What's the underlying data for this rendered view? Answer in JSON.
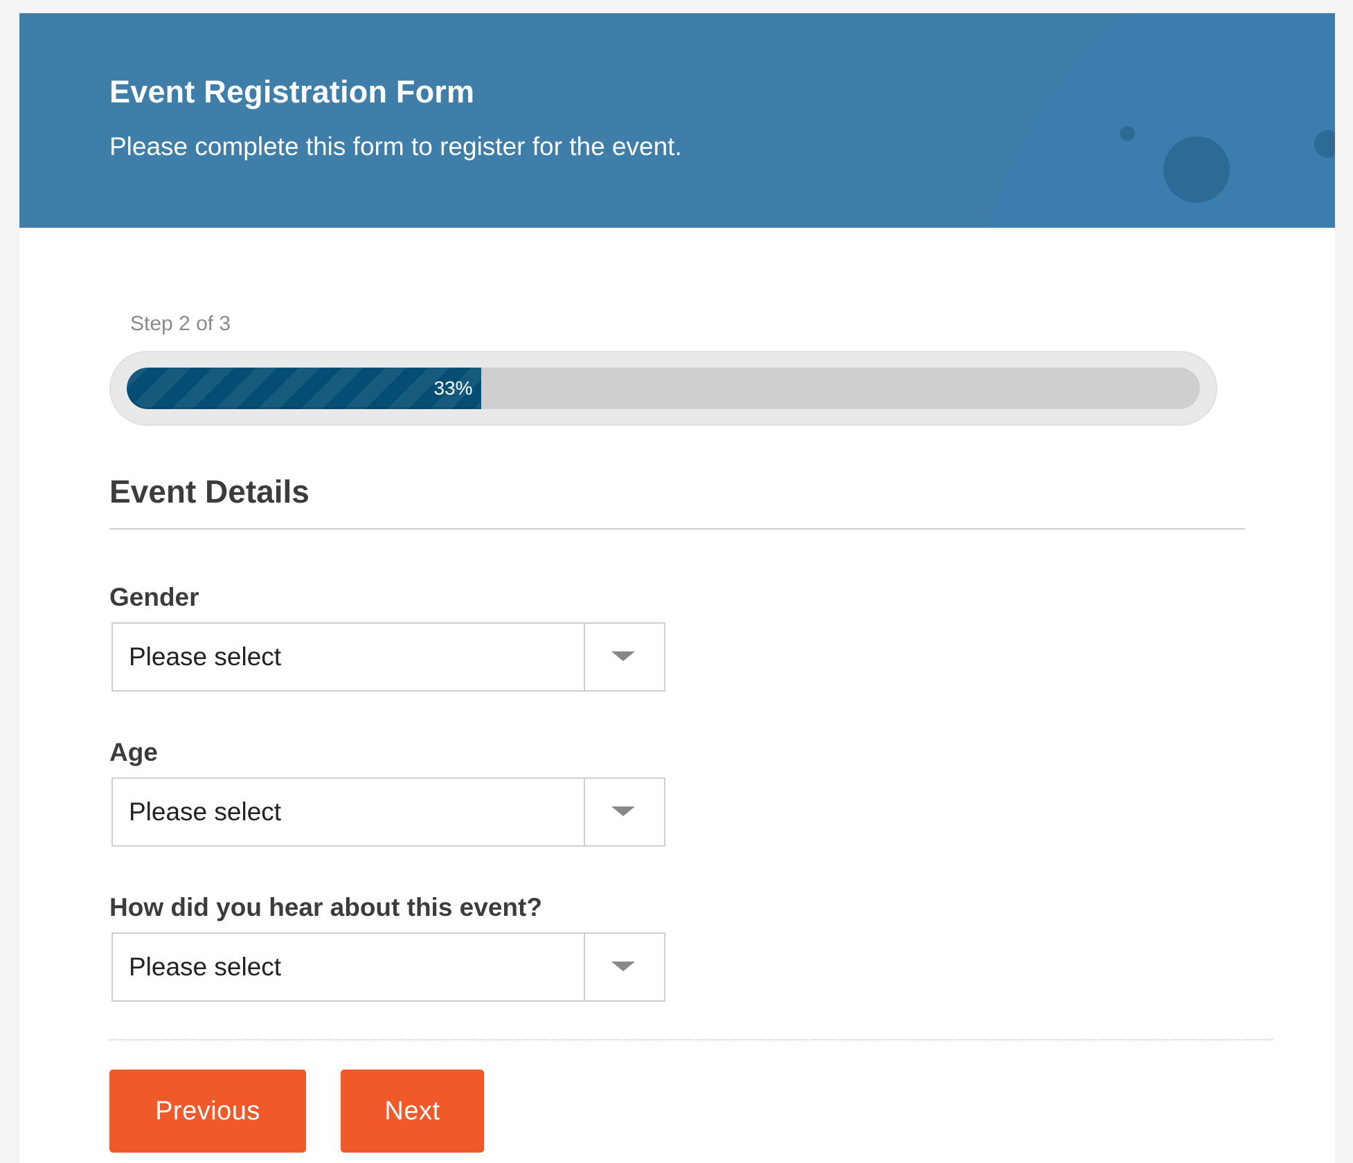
{
  "header": {
    "title": "Event Registration Form",
    "subtitle": "Please complete this form to register for the event.",
    "background_color": "#3f7ea9"
  },
  "progress": {
    "step_text": "Step 2 of 3",
    "percent": 33,
    "percent_label": "33%",
    "fill_color": "#044d73"
  },
  "section": {
    "title": "Event Details"
  },
  "fields": [
    {
      "label": "Gender",
      "value": "Please select",
      "icon": "chevron-down-icon"
    },
    {
      "label": "Age",
      "value": "Please select",
      "icon": "chevron-down-icon"
    },
    {
      "label": "How did you hear about this event?",
      "value": "Please select",
      "icon": "chevron-down-icon"
    }
  ],
  "buttons": {
    "previous_label": "Previous",
    "next_label": "Next",
    "color": "#f05a2a"
  }
}
